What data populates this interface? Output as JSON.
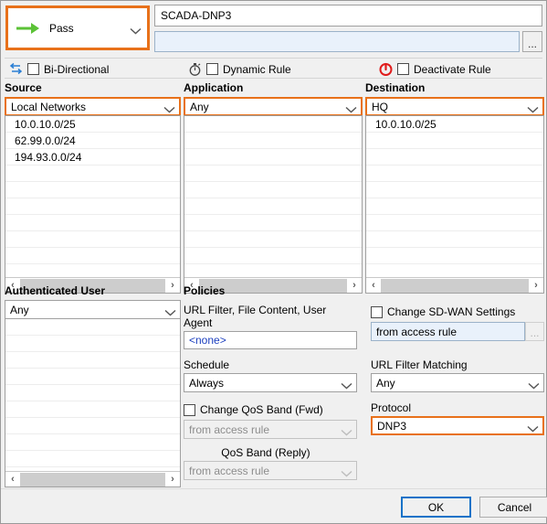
{
  "action": {
    "label": "Pass",
    "icon": "green-arrow-icon",
    "accent": "#e8711a"
  },
  "rule": {
    "name": "SCADA-DNP3",
    "comment": "",
    "browse_label": "..."
  },
  "flags": [
    {
      "label": "Bi-Directional",
      "icon": "bidirectional-arrows-icon",
      "checked": false
    },
    {
      "label": "Dynamic Rule",
      "icon": "stopwatch-icon",
      "checked": false
    },
    {
      "label": "Deactivate Rule",
      "icon": "power-off-icon",
      "checked": false
    }
  ],
  "source": {
    "title": "Source",
    "selected": "Local Networks",
    "highlighted": true,
    "items": [
      "10.0.10.0/25",
      "62.99.0.0/24",
      "194.93.0.0/24"
    ]
  },
  "application": {
    "title": "Application",
    "selected": "Any",
    "highlighted": true,
    "items": []
  },
  "destination": {
    "title": "Destination",
    "selected": "HQ",
    "highlighted": true,
    "items": [
      "10.0.10.0/25"
    ]
  },
  "authenticated_user": {
    "title": "Authenticated User",
    "selected": "Any",
    "items": []
  },
  "policies": {
    "title": "Policies",
    "url_filter_label": "URL Filter, File Content, User Agent",
    "url_filter_value": "<none>",
    "schedule_label": "Schedule",
    "schedule_value": "Always",
    "sdwan_checkbox_label": "Change SD-WAN Settings",
    "sdwan_checked": false,
    "sdwan_value": "from access rule",
    "sdwan_browse_label": "...",
    "url_matching_label": "URL Filter Matching",
    "url_matching_value": "Any",
    "qos_fwd_checkbox_label": "Change  QoS Band (Fwd)",
    "qos_fwd_checked": false,
    "qos_fwd_value": "from access rule",
    "qos_reply_label": "QoS Band (Reply)",
    "qos_reply_value": "from access rule",
    "protocol_label": "Protocol",
    "protocol_value": "DNP3",
    "protocol_highlighted": true
  },
  "scrollbars": {
    "left_arrow": "‹",
    "right_arrow": "›"
  },
  "buttons": {
    "ok": "OK",
    "cancel": "Cancel"
  }
}
